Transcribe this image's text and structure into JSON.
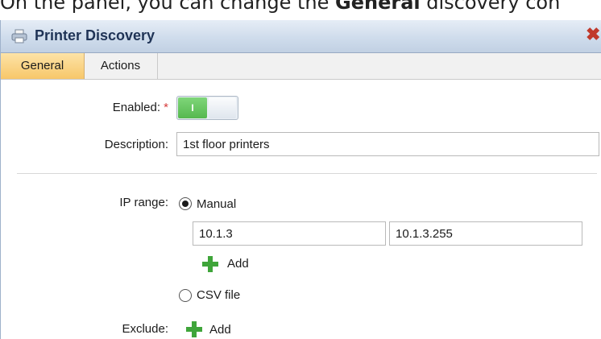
{
  "doc": {
    "prefix": "On the panel, you can change the ",
    "bold": "General",
    "suffix": " discovery con"
  },
  "window": {
    "title": "Printer Discovery",
    "title_icon": "printer-icon",
    "close_icon": "close-icon"
  },
  "tabs": [
    {
      "label": "General",
      "active": true
    },
    {
      "label": "Actions",
      "active": false
    }
  ],
  "form": {
    "enabled_label": "Enabled:",
    "required_marker": "*",
    "enabled_toggle_on_text": "I",
    "enabled": true,
    "description_label": "Description:",
    "description_value": "1st floor printers",
    "ip_range_label": "IP range:",
    "manual_label": "Manual",
    "manual_selected": true,
    "ip_from_value": "10.1.3",
    "ip_to_value": "10.1.3.255",
    "add_label": "Add",
    "csv_label": "CSV file",
    "csv_selected": false,
    "exclude_label": "Exclude:",
    "exclude_add_label": "Add"
  },
  "colors": {
    "accent_tab": "#f7c76a",
    "toggle_on": "#56b84f",
    "add_icon": "#3fa53a",
    "close": "#c0392b"
  }
}
